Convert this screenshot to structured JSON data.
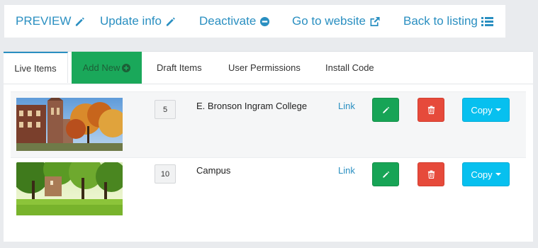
{
  "topbar": {
    "preview_label": "PREVIEW",
    "update_label": "Update info",
    "deactivate_label": "Deactivate",
    "website_label": "Go to website",
    "back_label": "Back to listing"
  },
  "tabs": {
    "live": "Live Items",
    "add": "Add New",
    "draft": "Draft Items",
    "permissions": "User Permissions",
    "install": "Install Code"
  },
  "items": [
    {
      "order": "5",
      "title": "E. Bronson Ingram College",
      "link_label": "Link",
      "copy_label": "Copy"
    },
    {
      "order": "10",
      "title": "Campus",
      "link_label": "Link",
      "copy_label": "Copy"
    }
  ],
  "colors": {
    "accent": "#2a8fc1",
    "success": "#17a456",
    "danger": "#e64a3b",
    "info": "#07c0ef"
  },
  "icons": {
    "preview": "pencil-icon",
    "update": "pencil-icon",
    "deactivate": "minus-circle-icon",
    "website": "external-link-icon",
    "back": "list-icon",
    "add": "plus-circle-icon",
    "edit": "pencil-icon",
    "delete": "trash-icon",
    "copy": "caret-down-icon"
  }
}
